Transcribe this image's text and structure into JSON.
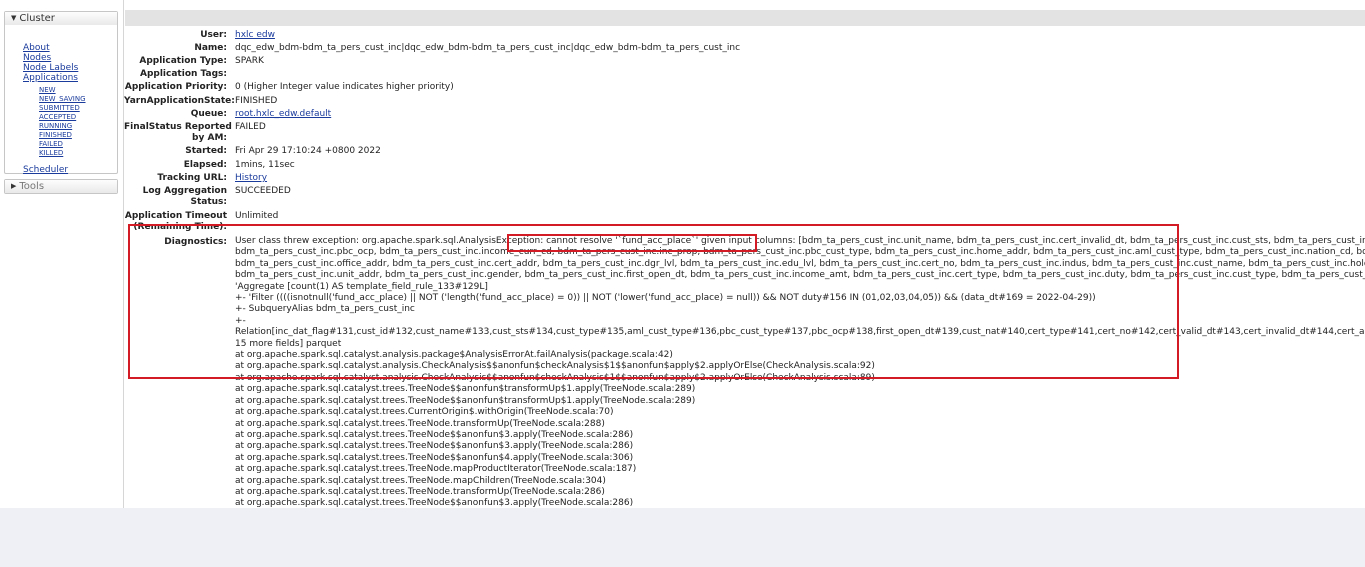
{
  "nav": {
    "cluster_title": "Cluster",
    "cluster_links": [
      "About",
      "Nodes",
      "Node Labels",
      "Applications"
    ],
    "app_states": [
      "NEW",
      "NEW_SAVING",
      "SUBMITTED",
      "ACCEPTED",
      "RUNNING",
      "FINISHED",
      "FAILED",
      "KILLED"
    ],
    "scheduler": "Scheduler",
    "tools_title": "Tools",
    "expanded_glyph": "▼",
    "collapsed_glyph": "▶"
  },
  "app": {
    "user_label": "User:",
    "user_value": "hxlc edw",
    "name_label": "Name:",
    "name_value": "dqc_edw_bdm-bdm_ta_pers_cust_inc|dqc_edw_bdm-bdm_ta_pers_cust_inc|dqc_edw_bdm-bdm_ta_pers_cust_inc",
    "type_label": "Application Type:",
    "type_value": "SPARK",
    "tags_label": "Application Tags:",
    "tags_value": "",
    "priority_label": "Application Priority:",
    "priority_value": "0 (Higher Integer value indicates higher priority)",
    "state_label": "YarnApplicationState:",
    "state_value": "FINISHED",
    "queue_label": "Queue:",
    "queue_value": "root.hxlc_edw.default",
    "final_label_1": "FinalStatus Reported",
    "final_label_2": "by AM:",
    "final_value": "FAILED",
    "started_label": "Started:",
    "started_value": "Fri Apr 29 17:10:24 +0800 2022",
    "elapsed_label": "Elapsed:",
    "elapsed_value": "1mins, 11sec",
    "tracking_label": "Tracking URL:",
    "tracking_value": "History",
    "logagg_label_1": "Log Aggregation",
    "logagg_label_2": "Status:",
    "logagg_value": "SUCCEEDED",
    "timeout_label_1": "Application Timeout",
    "timeout_label_2": "(Remaining Time):",
    "timeout_value": "Unlimited",
    "diag_label": "Diagnostics:"
  },
  "diagnostics": {
    "lines": [
      "User class threw exception: org.apache.spark.sql.AnalysisException: cannot resolve '`fund_acc_place`' given input columns: [bdm_ta_pers_cust_inc.unit_name, bdm_ta_pers_cust_inc.cert_invalid_dt, bdm_ta_pers_cust_inc.cust_sts, bdm_ta_pers_cust_inc.office_tel, bdm_ta_pe",
      "bdm_ta_pers_cust_inc.pbc_ocp, bdm_ta_pers_cust_inc.income_curr_cd, bdm_ta_pers_cust_inc.inc_prop, bdm_ta_pers_cust_inc.pbc_cust_type, bdm_ta_pers_cust_inc.home_addr, bdm_ta_pers_cust_inc.aml_cust_type, bdm_ta_pers_cust_inc.nation_cd, bdm_ta_pers_cust_inc.e",
      "bdm_ta_pers_cust_inc.office_addr, bdm_ta_pers_cust_inc.cert_addr, bdm_ta_pers_cust_inc.dgr_lvl, bdm_ta_pers_cust_inc.edu_lvl, bdm_ta_pers_cust_inc.cert_no, bdm_ta_pers_cust_inc.indus, bdm_ta_pers_cust_inc.cust_name, bdm_ta_pers_cust_inc.holder_risk_prefer, bdm_ta",
      "bdm_ta_pers_cust_inc.unit_addr, bdm_ta_pers_cust_inc.gender, bdm_ta_pers_cust_inc.first_open_dt, bdm_ta_pers_cust_inc.income_amt, bdm_ta_pers_cust_inc.cert_type, bdm_ta_pers_cust_inc.duty, bdm_ta_pers_cust_inc.cust_type, bdm_ta_pers_cust_inc.cust_id, bdm_ta_pe",
      "'Aggregate [count(1) AS template_field_rule_133#129L]",
      "+- 'Filter ((((isnotnull('fund_acc_place) || NOT ('length('fund_acc_place) = 0)) || NOT ('lower('fund_acc_place) = null)) && NOT duty#156 IN (01,02,03,04,05)) && (data_dt#169 = 2022-04-29))",
      "+- SubqueryAlias bdm_ta_pers_cust_inc",
      "+-",
      "Relation[inc_dat_flag#131,cust_id#132,cust_name#133,cust_sts#134,cust_type#135,aml_cust_type#136,pbc_cust_type#137,pbc_ocp#138,first_open_dt#139,cust_nat#140,cert_type#141,cert_no#142,cert_valid_dt#143,cert_invalid_dt#144,cert_addr#145,home_addr#146,of",
      "15 more fields] parquet",
      "at org.apache.spark.sql.catalyst.analysis.package$AnalysisErrorAt.failAnalysis(package.scala:42)",
      "at org.apache.spark.sql.catalyst.analysis.CheckAnalysis$$anonfun$checkAnalysis$1$$anonfun$apply$2.applyOrElse(CheckAnalysis.scala:92)",
      "at org.apache.spark.sql.catalyst.analysis.CheckAnalysis$$anonfun$checkAnalysis$1$$anonfun$apply$2.applyOrElse(CheckAnalysis.scala:89)",
      "at org.apache.spark.sql.catalyst.trees.TreeNode$$anonfun$transformUp$1.apply(TreeNode.scala:289)",
      "at org.apache.spark.sql.catalyst.trees.TreeNode$$anonfun$transformUp$1.apply(TreeNode.scala:289)",
      "at org.apache.spark.sql.catalyst.trees.CurrentOrigin$.withOrigin(TreeNode.scala:70)",
      "at org.apache.spark.sql.catalyst.trees.TreeNode.transformUp(TreeNode.scala:288)",
      "at org.apache.spark.sql.catalyst.trees.TreeNode$$anonfun$3.apply(TreeNode.scala:286)",
      "at org.apache.spark.sql.catalyst.trees.TreeNode$$anonfun$3.apply(TreeNode.scala:286)",
      "at org.apache.spark.sql.catalyst.trees.TreeNode$$anonfun$4.apply(TreeNode.scala:306)",
      "at org.apache.spark.sql.catalyst.trees.TreeNode.mapProductIterator(TreeNode.scala:187)",
      "at org.apache.spark.sql.catalyst.trees.TreeNode.mapChildren(TreeNode.scala:304)",
      "at org.apache.spark.sql.catalyst.trees.TreeNode.transformUp(TreeNode.scala:286)",
      "at org.apache.spark.sql.catalyst.trees.TreeNode$$anonfun$3.apply(TreeNode.scala:286)"
    ]
  },
  "colors": {
    "highlight": "#d31b25",
    "link": "#1a3b9c",
    "page_bg": "#eef0f6"
  }
}
